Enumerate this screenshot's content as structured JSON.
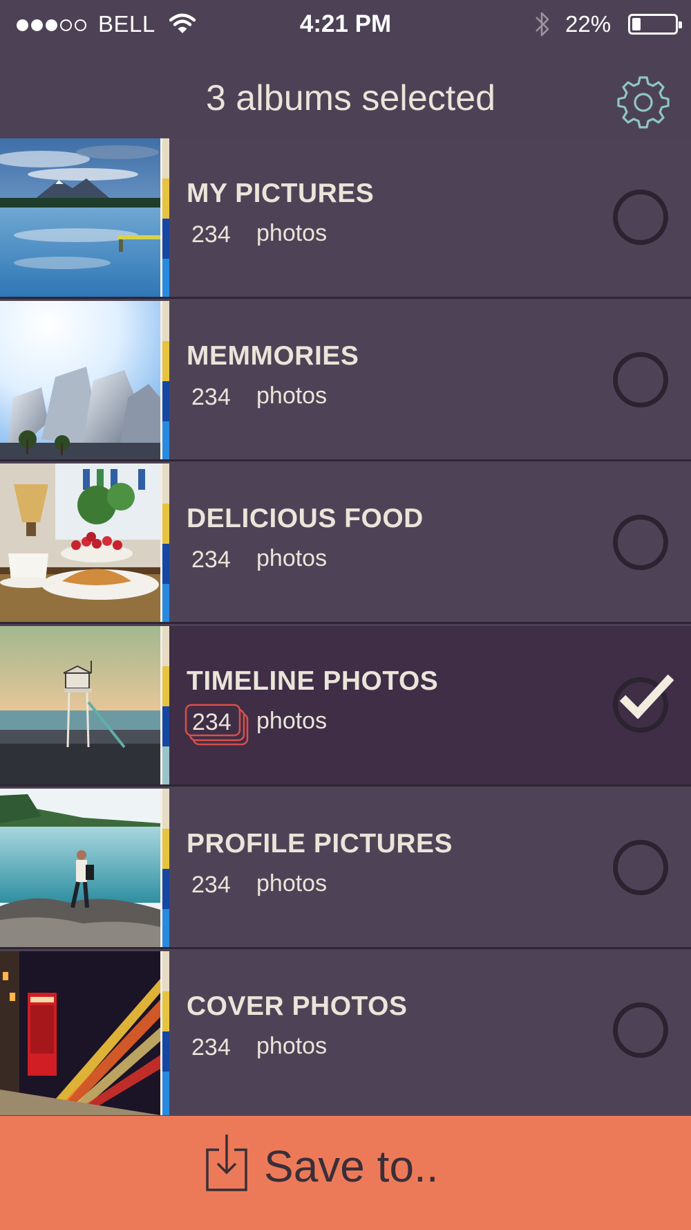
{
  "status_bar": {
    "carrier": "BELL",
    "signal_bars_filled": 3,
    "signal_bars_total": 5,
    "time": "4:21 PM",
    "battery": "22%",
    "battery_level": 0.22,
    "icons": [
      "wifi-icon",
      "bluetooth-icon",
      "battery-icon"
    ]
  },
  "header": {
    "title": "3 albums selected",
    "settings_icon": "gear-icon"
  },
  "albums": [
    {
      "title": "MY PICTURES",
      "count": "234",
      "count_label": "photos",
      "selected": false,
      "thumbnail": "mountain-lake"
    },
    {
      "title": "MEMMORIES",
      "count": "234",
      "count_label": "photos",
      "selected": false,
      "thumbnail": "modern-building"
    },
    {
      "title": "DELICIOUS FOOD",
      "count": "234",
      "count_label": "photos",
      "selected": false,
      "thumbnail": "breakfast-table"
    },
    {
      "title": "TIMELINE PHOTOS",
      "count": "234",
      "count_label": "photos",
      "selected": true,
      "thumbnail": "lifeguard-tower"
    },
    {
      "title": "PROFILE PICTURES",
      "count": "234",
      "count_label": "photos",
      "selected": false,
      "thumbnail": "hiker-on-rocks"
    },
    {
      "title": "COVER PHOTOS",
      "count": "234",
      "count_label": "photos",
      "selected": false,
      "thumbnail": "phone-booth-night"
    }
  ],
  "save_bar": {
    "label": "Save to..",
    "icon": "download-icon"
  },
  "colors": {
    "background": "#4d4255",
    "selected_row": "#3f2e46",
    "text": "#ebe4d9",
    "save_bar": "#ec7a59",
    "stack_badge": "#d9504a"
  }
}
